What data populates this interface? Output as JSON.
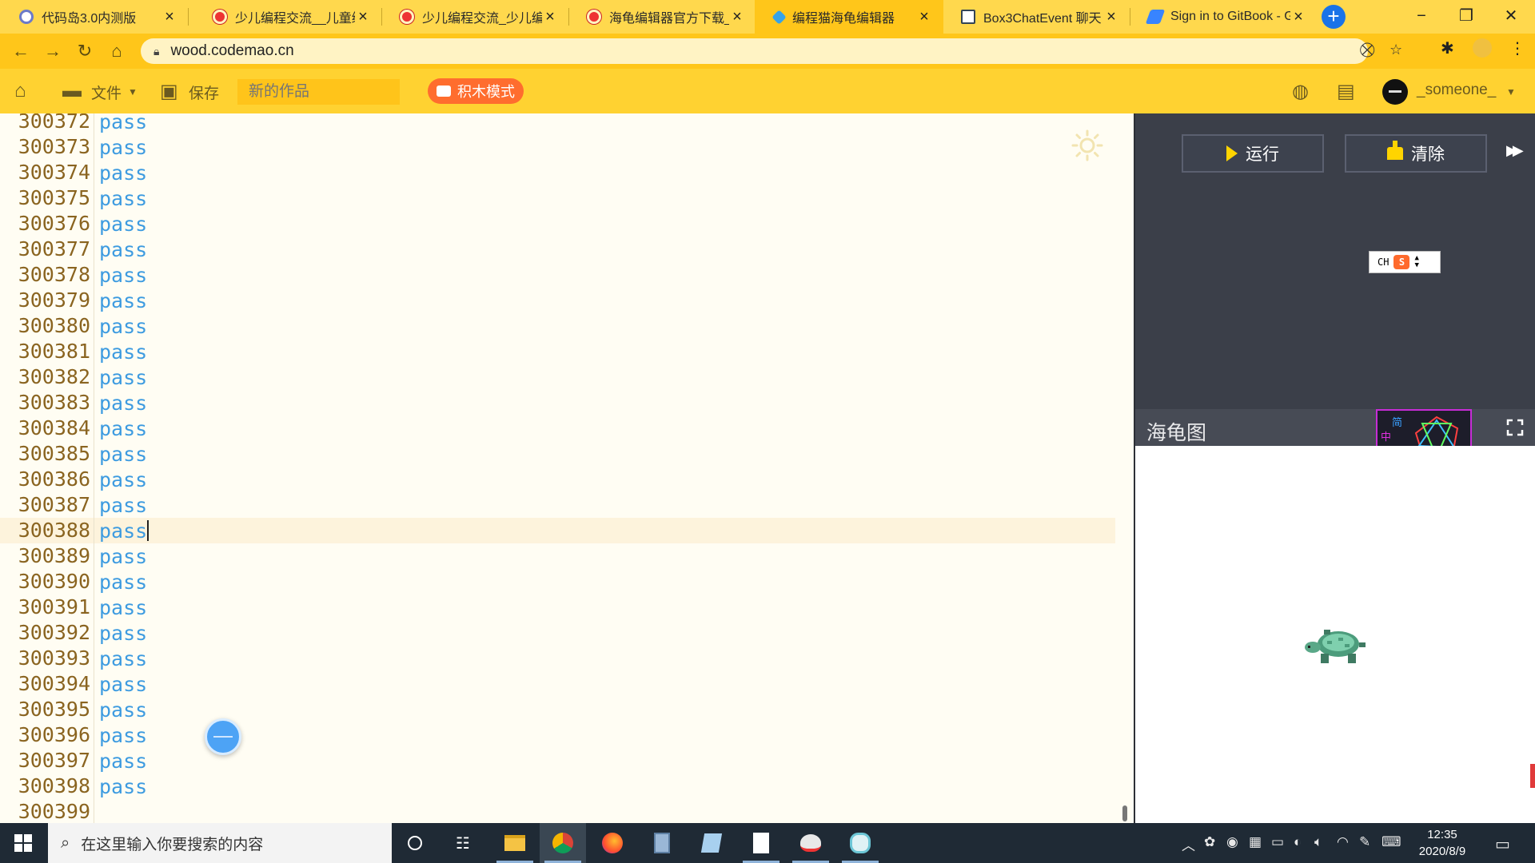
{
  "browser": {
    "tabs": [
      {
        "title": "代码岛3.0内测版",
        "favicon": "gear-favicon",
        "active": false
      },
      {
        "title": "少儿编程交流__儿童编",
        "favicon": "codemao-favicon",
        "active": false
      },
      {
        "title": "少儿编程交流_少儿编程",
        "favicon": "codemao-favicon",
        "active": false
      },
      {
        "title": "海龟编辑器官方下载_P",
        "favicon": "codemao-favicon",
        "active": false
      },
      {
        "title": "编程猫海龟编辑器",
        "favicon": "turtle-favicon",
        "active": true
      },
      {
        "title": "Box3ChatEvent 聊天",
        "favicon": "book-favicon",
        "active": false
      },
      {
        "title": "Sign in to GitBook - G",
        "favicon": "gitbook-favicon",
        "active": false
      }
    ],
    "url": "wood.codemao.cn"
  },
  "app_header": {
    "file_label": "文件",
    "save_label": "保存",
    "title_placeholder": "新的作品",
    "block_mode_label": "积木模式",
    "username": "_someone_"
  },
  "editor": {
    "current_line": "300388",
    "lines": [
      {
        "num": "300372",
        "text": "pass"
      },
      {
        "num": "300373",
        "text": "pass"
      },
      {
        "num": "300374",
        "text": "pass"
      },
      {
        "num": "300375",
        "text": "pass"
      },
      {
        "num": "300376",
        "text": "pass"
      },
      {
        "num": "300377",
        "text": "pass"
      },
      {
        "num": "300378",
        "text": "pass"
      },
      {
        "num": "300379",
        "text": "pass"
      },
      {
        "num": "300380",
        "text": "pass"
      },
      {
        "num": "300381",
        "text": "pass"
      },
      {
        "num": "300382",
        "text": "pass"
      },
      {
        "num": "300383",
        "text": "pass"
      },
      {
        "num": "300384",
        "text": "pass"
      },
      {
        "num": "300385",
        "text": "pass"
      },
      {
        "num": "300386",
        "text": "pass"
      },
      {
        "num": "300387",
        "text": "pass"
      },
      {
        "num": "300388",
        "text": "pass"
      },
      {
        "num": "300389",
        "text": "pass"
      },
      {
        "num": "300390",
        "text": "pass"
      },
      {
        "num": "300391",
        "text": "pass"
      },
      {
        "num": "300392",
        "text": "pass"
      },
      {
        "num": "300393",
        "text": "pass"
      },
      {
        "num": "300394",
        "text": "pass"
      },
      {
        "num": "300395",
        "text": "pass"
      },
      {
        "num": "300396",
        "text": "pass"
      },
      {
        "num": "300397",
        "text": "pass"
      },
      {
        "num": "300398",
        "text": "pass"
      },
      {
        "num": "300399",
        "text": ""
      }
    ]
  },
  "right_panel": {
    "run_label": "运行",
    "clear_label": "清除",
    "ime_text": "CH",
    "ime_logo": "S",
    "turtle_title": "海龟图",
    "ime_skin_chars": [
      "简",
      "中"
    ]
  },
  "taskbar": {
    "search_placeholder": "在这里输入你要搜索的内容",
    "time": "12:35",
    "date": "2020/8/9"
  },
  "colors": {
    "browser_chrome": "#ffc61a",
    "app_header": "#ffd231",
    "block_mode": "#ff6d2e",
    "code_keyword": "#3d9be0",
    "line_number": "#8a6420",
    "panel_bg": "#3b3f49"
  }
}
